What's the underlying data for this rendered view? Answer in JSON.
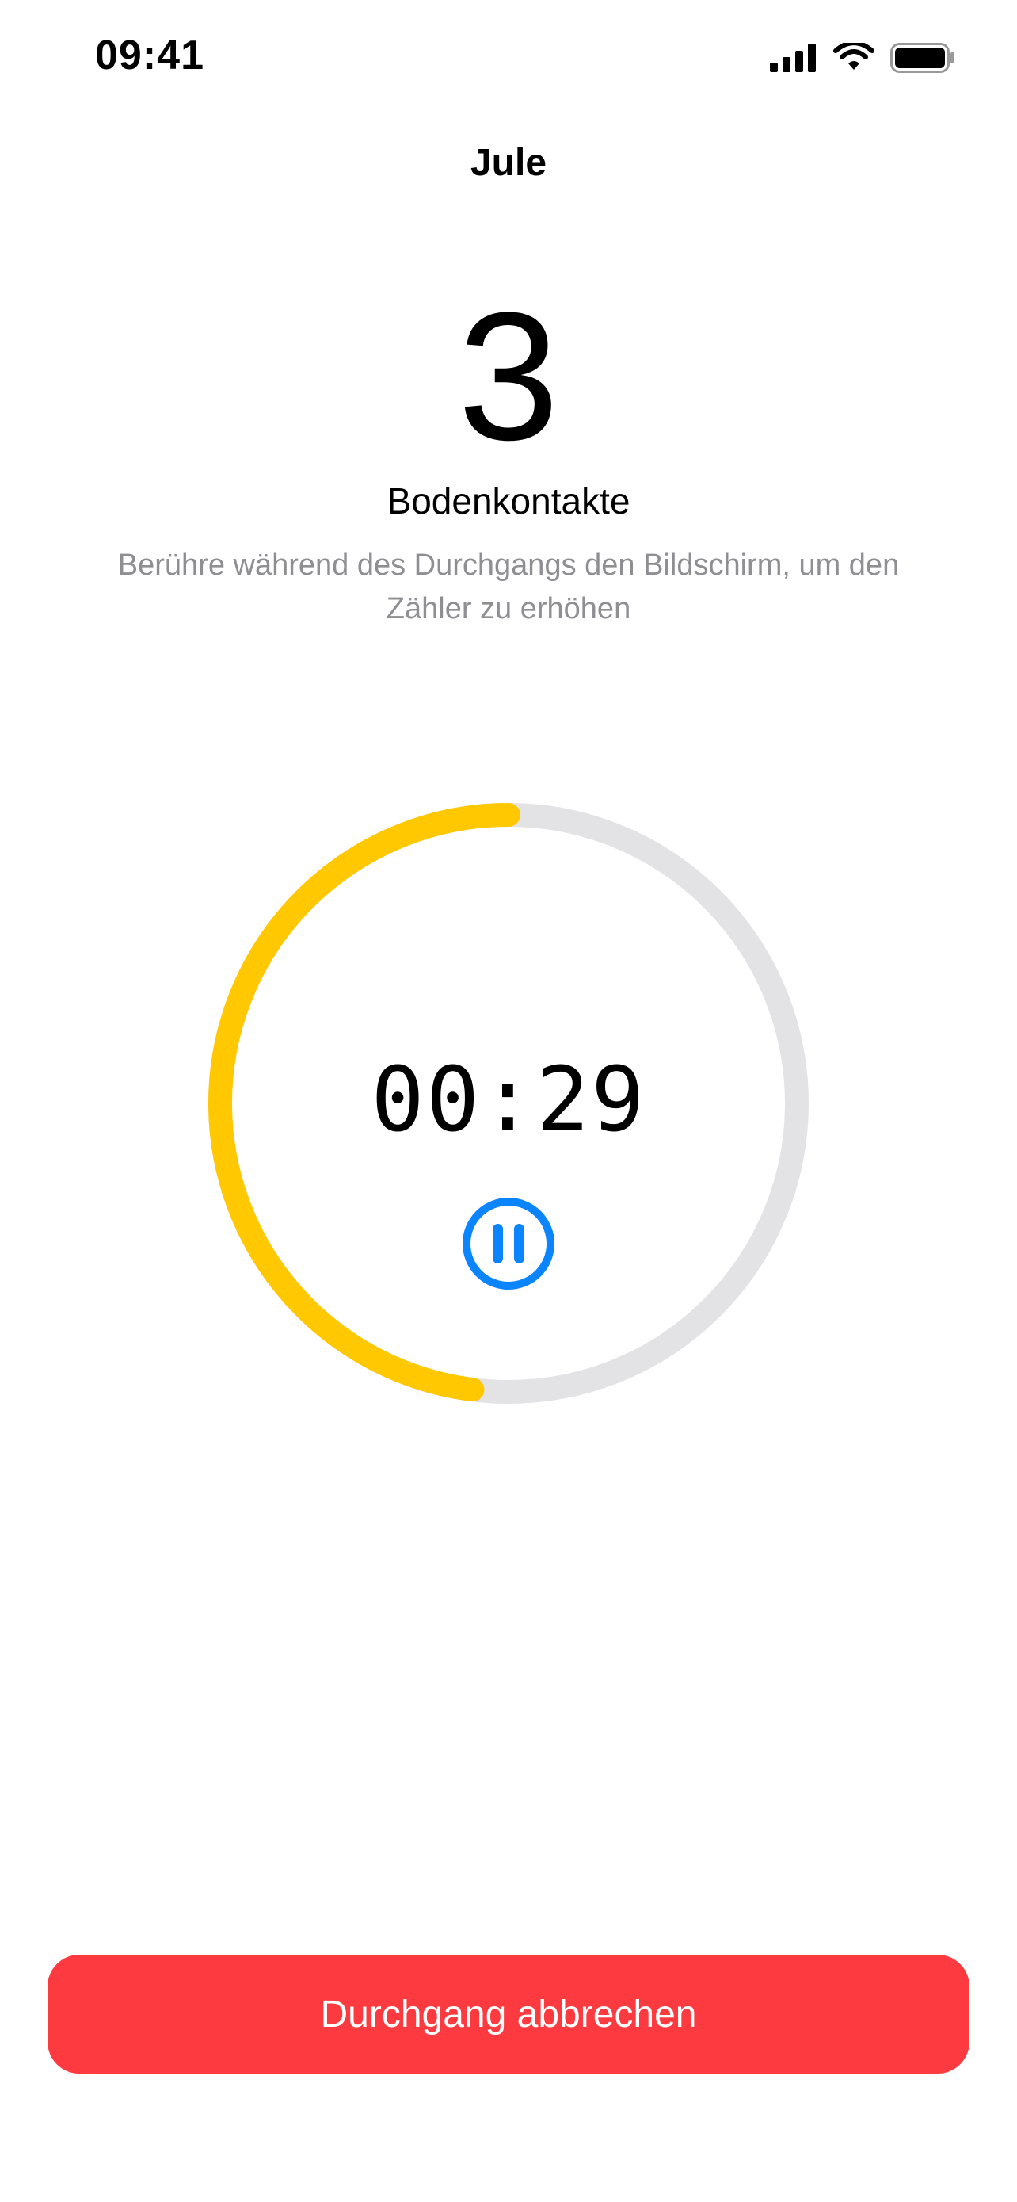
{
  "status_bar": {
    "time": "09:41",
    "icons": [
      "cellular-signal-icon",
      "wifi-icon",
      "battery-icon"
    ]
  },
  "header": {
    "title": "Jule"
  },
  "counter": {
    "value": "3",
    "label": "Bodenkontakte",
    "hint": "Berühre während des Durchgangs den Bildschirm, um den Zähler zu erhöhen"
  },
  "timer": {
    "display": "00:29",
    "progress_fraction": 0.48,
    "pause_icon": "pause-circle-icon"
  },
  "actions": {
    "cancel_label": "Durchgang abbrechen"
  },
  "colors": {
    "progress": "#ffc800",
    "track": "#e3e3e6",
    "accent": "#0a84ff",
    "destructive": "#fc3a3f"
  }
}
